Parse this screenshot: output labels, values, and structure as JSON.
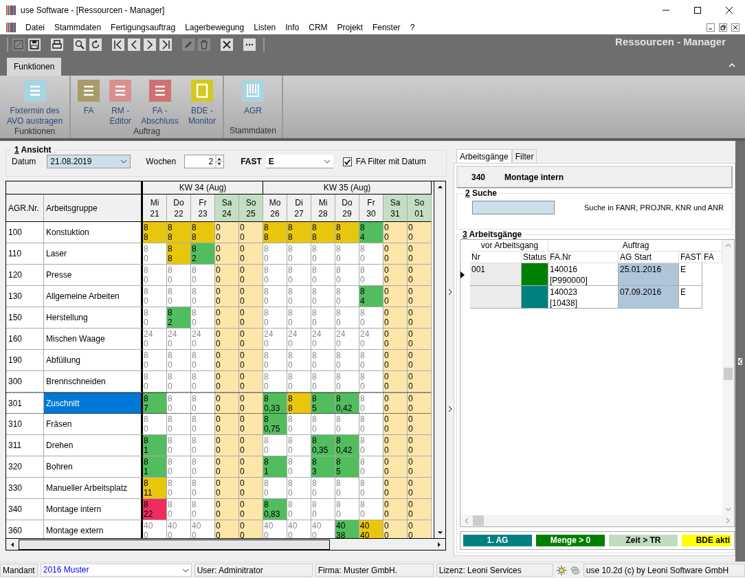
{
  "window": {
    "title": "use Software - [Ressourcen - Manager]"
  },
  "menu": [
    "Datei",
    "Stammdaten",
    "Fertigungsauftrag",
    "Lagerbewegung",
    "Listen",
    "Info",
    "CRM",
    "Projekt",
    "Fenster",
    "?"
  ],
  "toolbar": [
    {
      "kind": "new",
      "disabled": true
    },
    {
      "kind": "save",
      "disabled": false
    },
    {
      "kind": "print",
      "disabled": false
    },
    {
      "kind": "search",
      "disabled": false
    },
    {
      "kind": "refresh",
      "disabled": false
    },
    {
      "kind": "first",
      "disabled": false
    },
    {
      "kind": "prev",
      "disabled": false
    },
    {
      "kind": "next",
      "disabled": false
    },
    {
      "kind": "last",
      "disabled": false
    },
    {
      "kind": "edit",
      "disabled": true
    },
    {
      "kind": "delete",
      "disabled": true
    },
    {
      "kind": "close",
      "disabled": false
    },
    {
      "kind": "more",
      "disabled": false
    }
  ],
  "module_title": "Ressourcen - Manager",
  "ribbon_tabs": [
    {
      "label": "Funktionen",
      "selected": true
    }
  ],
  "ribbon_groups": [
    {
      "label": "Funktionen",
      "buttons": [
        {
          "label_lines": [
            "Fixtermin des",
            "AVO austragen"
          ],
          "kind": "list",
          "color": "#a8d4e0"
        }
      ]
    },
    {
      "label": "Auftrag",
      "buttons": [
        {
          "label_lines": [
            "FA"
          ],
          "kind": "list",
          "color": "#a89a6a"
        },
        {
          "label_lines": [
            "RM -",
            "Editor"
          ],
          "kind": "list",
          "color": "#d89090"
        },
        {
          "label_lines": [
            "FA -",
            "Abschluss"
          ],
          "kind": "list",
          "color": "#d07070"
        },
        {
          "label_lines": [
            "BDE -",
            "Monitor"
          ],
          "kind": "frame",
          "color": "#d4c820"
        }
      ]
    },
    {
      "label": "Stammdaten",
      "buttons": [
        {
          "label_lines": [
            "AGR"
          ],
          "kind": "columns",
          "color": "#a8d4e0"
        }
      ]
    }
  ],
  "view": {
    "title_key": "1",
    "title": "Ansicht",
    "date_label": "Datum",
    "date": "21.08.2019",
    "weeks_label": "Wochen",
    "weeks": "2",
    "fast_label": "FAST",
    "fast": "E",
    "date_filter_label": "FA Filter mit Datum",
    "date_filter_checked": true
  },
  "table": {
    "columns": [
      "AGR.Nr.",
      "Arbeitsgruppe"
    ],
    "weeks": [
      {
        "label": "KW 34 (Aug)",
        "days": [
          {
            "weekday": "Mi",
            "date": "21",
            "weekend": false
          },
          {
            "weekday": "Do",
            "date": "22",
            "weekend": false
          },
          {
            "weekday": "Fr",
            "date": "23",
            "weekend": false
          },
          {
            "weekday": "Sa",
            "date": "24",
            "weekend": true
          },
          {
            "weekday": "So",
            "date": "25",
            "weekend": true
          }
        ]
      },
      {
        "label": "KW 35 (Aug)",
        "days": [
          {
            "weekday": "Mo",
            "date": "26",
            "weekend": false
          },
          {
            "weekday": "Di",
            "date": "27",
            "weekend": false
          },
          {
            "weekday": "Mi",
            "date": "28",
            "weekend": false
          },
          {
            "weekday": "Do",
            "date": "29",
            "weekend": false
          },
          {
            "weekday": "Fr",
            "date": "30",
            "weekend": false
          },
          {
            "weekday": "Sa",
            "date": "31",
            "weekend": true
          },
          {
            "weekday": "So",
            "date": "01",
            "weekend": true
          }
        ]
      }
    ],
    "rows": [
      {
        "nr": "100",
        "name": "Konstuktion",
        "selected": false,
        "cells": [
          {
            "plan": "8",
            "booked": "8",
            "color": "#e9c60e"
          },
          {
            "plan": "8",
            "booked": "8",
            "color": "#e9c60e"
          },
          {
            "plan": "8",
            "booked": "8",
            "color": "#e9c60e"
          },
          {
            "plan": "0",
            "booked": "0",
            "color": "#fde6aa"
          },
          {
            "plan": "0",
            "booked": "0",
            "color": "#fde6aa"
          },
          {
            "plan": "8",
            "booked": "8",
            "color": "#e9c60e"
          },
          {
            "plan": "8",
            "booked": "8",
            "color": "#e9c60e"
          },
          {
            "plan": "8",
            "booked": "8",
            "color": "#e9c60e"
          },
          {
            "plan": "8",
            "booked": "8",
            "color": "#e9c60e"
          },
          {
            "plan": "8",
            "booked": "4",
            "color": "#52bd5e"
          },
          {
            "plan": "0",
            "booked": "0",
            "color": "#fde6aa"
          },
          {
            "plan": "0",
            "booked": "0",
            "color": "#fde6aa"
          }
        ]
      },
      {
        "nr": "110",
        "name": "Laser",
        "selected": false,
        "cells": [
          {
            "plan": "8",
            "booked": "0",
            "color": "#ffffff"
          },
          {
            "plan": "8",
            "booked": "8",
            "color": "#e9c60e"
          },
          {
            "plan": "8",
            "booked": "2",
            "color": "#52bd5e"
          },
          {
            "plan": "0",
            "booked": "0",
            "color": "#fde6aa"
          },
          {
            "plan": "0",
            "booked": "0",
            "color": "#fde6aa"
          },
          {
            "plan": "8",
            "booked": "0",
            "color": "#ffffff"
          },
          {
            "plan": "8",
            "booked": "0",
            "color": "#ffffff"
          },
          {
            "plan": "8",
            "booked": "0",
            "color": "#ffffff"
          },
          {
            "plan": "8",
            "booked": "0",
            "color": "#ffffff"
          },
          {
            "plan": "8",
            "booked": "0",
            "color": "#ffffff"
          },
          {
            "plan": "0",
            "booked": "0",
            "color": "#fde6aa"
          },
          {
            "plan": "0",
            "booked": "0",
            "color": "#fde6aa"
          }
        ]
      },
      {
        "nr": "120",
        "name": "Presse",
        "selected": false,
        "cells": [
          {
            "plan": "8",
            "booked": "0",
            "color": "#ffffff"
          },
          {
            "plan": "8",
            "booked": "0",
            "color": "#ffffff"
          },
          {
            "plan": "8",
            "booked": "0",
            "color": "#ffffff"
          },
          {
            "plan": "0",
            "booked": "0",
            "color": "#fde6aa"
          },
          {
            "plan": "0",
            "booked": "0",
            "color": "#fde6aa"
          },
          {
            "plan": "8",
            "booked": "0",
            "color": "#ffffff"
          },
          {
            "plan": "8",
            "booked": "0",
            "color": "#ffffff"
          },
          {
            "plan": "8",
            "booked": "0",
            "color": "#ffffff"
          },
          {
            "plan": "8",
            "booked": "0",
            "color": "#ffffff"
          },
          {
            "plan": "8",
            "booked": "0",
            "color": "#ffffff"
          },
          {
            "plan": "0",
            "booked": "0",
            "color": "#fde6aa"
          },
          {
            "plan": "0",
            "booked": "0",
            "color": "#fde6aa"
          }
        ]
      },
      {
        "nr": "130",
        "name": "Allgemeine Arbeiten",
        "selected": false,
        "cells": [
          {
            "plan": "8",
            "booked": "0",
            "color": "#ffffff"
          },
          {
            "plan": "8",
            "booked": "0",
            "color": "#ffffff"
          },
          {
            "plan": "8",
            "booked": "0",
            "color": "#ffffff"
          },
          {
            "plan": "0",
            "booked": "0",
            "color": "#fde6aa"
          },
          {
            "plan": "0",
            "booked": "0",
            "color": "#fde6aa"
          },
          {
            "plan": "8",
            "booked": "0",
            "color": "#ffffff"
          },
          {
            "plan": "8",
            "booked": "0",
            "color": "#ffffff"
          },
          {
            "plan": "8",
            "booked": "0",
            "color": "#ffffff"
          },
          {
            "plan": "8",
            "booked": "0",
            "color": "#ffffff"
          },
          {
            "plan": "8",
            "booked": "4",
            "color": "#52bd5e"
          },
          {
            "plan": "0",
            "booked": "0",
            "color": "#fde6aa"
          },
          {
            "plan": "0",
            "booked": "0",
            "color": "#fde6aa"
          }
        ]
      },
      {
        "nr": "150",
        "name": "Herstellung",
        "selected": false,
        "cells": [
          {
            "plan": "8",
            "booked": "0",
            "color": "#ffffff"
          },
          {
            "plan": "8",
            "booked": "2",
            "color": "#52bd5e"
          },
          {
            "plan": "8",
            "booked": "0",
            "color": "#ffffff"
          },
          {
            "plan": "0",
            "booked": "0",
            "color": "#fde6aa"
          },
          {
            "plan": "0",
            "booked": "0",
            "color": "#fde6aa"
          },
          {
            "plan": "8",
            "booked": "0",
            "color": "#ffffff"
          },
          {
            "plan": "8",
            "booked": "0",
            "color": "#ffffff"
          },
          {
            "plan": "8",
            "booked": "0",
            "color": "#ffffff"
          },
          {
            "plan": "8",
            "booked": "0",
            "color": "#ffffff"
          },
          {
            "plan": "8",
            "booked": "0",
            "color": "#ffffff"
          },
          {
            "plan": "0",
            "booked": "0",
            "color": "#fde6aa"
          },
          {
            "plan": "0",
            "booked": "0",
            "color": "#fde6aa"
          }
        ]
      },
      {
        "nr": "160",
        "name": "Mischen Waage",
        "selected": false,
        "cells": [
          {
            "plan": "24",
            "booked": "0",
            "color": "#ffffff"
          },
          {
            "plan": "24",
            "booked": "0",
            "color": "#ffffff"
          },
          {
            "plan": "24",
            "booked": "0",
            "color": "#ffffff"
          },
          {
            "plan": "0",
            "booked": "0",
            "color": "#fde6aa"
          },
          {
            "plan": "0",
            "booked": "0",
            "color": "#fde6aa"
          },
          {
            "plan": "24",
            "booked": "0",
            "color": "#ffffff"
          },
          {
            "plan": "24",
            "booked": "0",
            "color": "#ffffff"
          },
          {
            "plan": "24",
            "booked": "0",
            "color": "#ffffff"
          },
          {
            "plan": "24",
            "booked": "0",
            "color": "#ffffff"
          },
          {
            "plan": "24",
            "booked": "0",
            "color": "#ffffff"
          },
          {
            "plan": "0",
            "booked": "0",
            "color": "#fde6aa"
          },
          {
            "plan": "0",
            "booked": "0",
            "color": "#fde6aa"
          }
        ]
      },
      {
        "nr": "190",
        "name": "Abfüllung",
        "selected": false,
        "cells": [
          {
            "plan": "8",
            "booked": "0",
            "color": "#ffffff"
          },
          {
            "plan": "8",
            "booked": "0",
            "color": "#ffffff"
          },
          {
            "plan": "8",
            "booked": "0",
            "color": "#ffffff"
          },
          {
            "plan": "0",
            "booked": "0",
            "color": "#fde6aa"
          },
          {
            "plan": "0",
            "booked": "0",
            "color": "#fde6aa"
          },
          {
            "plan": "8",
            "booked": "0",
            "color": "#ffffff"
          },
          {
            "plan": "8",
            "booked": "0",
            "color": "#ffffff"
          },
          {
            "plan": "8",
            "booked": "0",
            "color": "#ffffff"
          },
          {
            "plan": "8",
            "booked": "0",
            "color": "#ffffff"
          },
          {
            "plan": "8",
            "booked": "0",
            "color": "#ffffff"
          },
          {
            "plan": "0",
            "booked": "0",
            "color": "#fde6aa"
          },
          {
            "plan": "0",
            "booked": "0",
            "color": "#fde6aa"
          }
        ]
      },
      {
        "nr": "300",
        "name": "Brennschneiden",
        "selected": false,
        "cells": [
          {
            "plan": "8",
            "booked": "0",
            "color": "#ffffff"
          },
          {
            "plan": "8",
            "booked": "0",
            "color": "#ffffff"
          },
          {
            "plan": "8",
            "booked": "0",
            "color": "#ffffff"
          },
          {
            "plan": "0",
            "booked": "0",
            "color": "#fde6aa"
          },
          {
            "plan": "0",
            "booked": "0",
            "color": "#fde6aa"
          },
          {
            "plan": "8",
            "booked": "0",
            "color": "#ffffff"
          },
          {
            "plan": "8",
            "booked": "0",
            "color": "#ffffff"
          },
          {
            "plan": "8",
            "booked": "0",
            "color": "#ffffff"
          },
          {
            "plan": "8",
            "booked": "0",
            "color": "#ffffff"
          },
          {
            "plan": "8",
            "booked": "0",
            "color": "#ffffff"
          },
          {
            "plan": "0",
            "booked": "0",
            "color": "#fde6aa"
          },
          {
            "plan": "0",
            "booked": "0",
            "color": "#fde6aa"
          }
        ]
      },
      {
        "nr": "301",
        "name": "Zuschnitt",
        "selected": true,
        "cells": [
          {
            "plan": "8",
            "booked": "7",
            "color": "#52bd5e"
          },
          {
            "plan": "8",
            "booked": "0",
            "color": "#ffffff"
          },
          {
            "plan": "8",
            "booked": "0",
            "color": "#ffffff"
          },
          {
            "plan": "0",
            "booked": "0",
            "color": "#fde6aa"
          },
          {
            "plan": "0",
            "booked": "0",
            "color": "#fde6aa"
          },
          {
            "plan": "8",
            "booked": "0,33",
            "color": "#52bd5e"
          },
          {
            "plan": "8",
            "booked": "8",
            "color": "#e9c60e"
          },
          {
            "plan": "8",
            "booked": "5",
            "color": "#52bd5e"
          },
          {
            "plan": "8",
            "booked": "0,42",
            "color": "#52bd5e"
          },
          {
            "plan": "8",
            "booked": "0",
            "color": "#ffffff"
          },
          {
            "plan": "0",
            "booked": "0",
            "color": "#fde6aa"
          },
          {
            "plan": "0",
            "booked": "0",
            "color": "#fde6aa"
          }
        ]
      },
      {
        "nr": "310",
        "name": "Fräsen",
        "selected": false,
        "cells": [
          {
            "plan": "8",
            "booked": "0",
            "color": "#ffffff"
          },
          {
            "plan": "8",
            "booked": "0",
            "color": "#ffffff"
          },
          {
            "plan": "8",
            "booked": "0",
            "color": "#ffffff"
          },
          {
            "plan": "0",
            "booked": "0",
            "color": "#fde6aa"
          },
          {
            "plan": "0",
            "booked": "0",
            "color": "#fde6aa"
          },
          {
            "plan": "8",
            "booked": "0,75",
            "color": "#52bd5e"
          },
          {
            "plan": "8",
            "booked": "0",
            "color": "#ffffff"
          },
          {
            "plan": "8",
            "booked": "0",
            "color": "#ffffff"
          },
          {
            "plan": "8",
            "booked": "0",
            "color": "#ffffff"
          },
          {
            "plan": "8",
            "booked": "0",
            "color": "#ffffff"
          },
          {
            "plan": "0",
            "booked": "0",
            "color": "#fde6aa"
          },
          {
            "plan": "0",
            "booked": "0",
            "color": "#fde6aa"
          }
        ]
      },
      {
        "nr": "311",
        "name": "Drehen",
        "selected": false,
        "cells": [
          {
            "plan": "8",
            "booked": "1",
            "color": "#52bd5e"
          },
          {
            "plan": "8",
            "booked": "0",
            "color": "#ffffff"
          },
          {
            "plan": "8",
            "booked": "0",
            "color": "#ffffff"
          },
          {
            "plan": "0",
            "booked": "0",
            "color": "#fde6aa"
          },
          {
            "plan": "0",
            "booked": "0",
            "color": "#fde6aa"
          },
          {
            "plan": "8",
            "booked": "0",
            "color": "#ffffff"
          },
          {
            "plan": "8",
            "booked": "0",
            "color": "#ffffff"
          },
          {
            "plan": "8",
            "booked": "0,35",
            "color": "#52bd5e"
          },
          {
            "plan": "8",
            "booked": "0,42",
            "color": "#52bd5e"
          },
          {
            "plan": "8",
            "booked": "0",
            "color": "#ffffff"
          },
          {
            "plan": "0",
            "booked": "0",
            "color": "#fde6aa"
          },
          {
            "plan": "0",
            "booked": "0",
            "color": "#fde6aa"
          }
        ]
      },
      {
        "nr": "320",
        "name": "Bohren",
        "selected": false,
        "cells": [
          {
            "plan": "8",
            "booked": "1",
            "color": "#52bd5e"
          },
          {
            "plan": "8",
            "booked": "0",
            "color": "#ffffff"
          },
          {
            "plan": "8",
            "booked": "0",
            "color": "#ffffff"
          },
          {
            "plan": "0",
            "booked": "0",
            "color": "#fde6aa"
          },
          {
            "plan": "0",
            "booked": "0",
            "color": "#fde6aa"
          },
          {
            "plan": "8",
            "booked": "1",
            "color": "#52bd5e"
          },
          {
            "plan": "8",
            "booked": "0",
            "color": "#ffffff"
          },
          {
            "plan": "8",
            "booked": "3",
            "color": "#52bd5e"
          },
          {
            "plan": "8",
            "booked": "5",
            "color": "#52bd5e"
          },
          {
            "plan": "8",
            "booked": "0",
            "color": "#ffffff"
          },
          {
            "plan": "0",
            "booked": "0",
            "color": "#fde6aa"
          },
          {
            "plan": "0",
            "booked": "0",
            "color": "#fde6aa"
          }
        ]
      },
      {
        "nr": "330",
        "name": "Manueller Arbeitsplatz",
        "selected": false,
        "cells": [
          {
            "plan": "8",
            "booked": "11",
            "color": "#e9c60e"
          },
          {
            "plan": "8",
            "booked": "0",
            "color": "#ffffff"
          },
          {
            "plan": "8",
            "booked": "0",
            "color": "#ffffff"
          },
          {
            "plan": "0",
            "booked": "0",
            "color": "#fde6aa"
          },
          {
            "plan": "0",
            "booked": "0",
            "color": "#fde6aa"
          },
          {
            "plan": "8",
            "booked": "0",
            "color": "#ffffff"
          },
          {
            "plan": "8",
            "booked": "0",
            "color": "#ffffff"
          },
          {
            "plan": "8",
            "booked": "0",
            "color": "#ffffff"
          },
          {
            "plan": "8",
            "booked": "0",
            "color": "#ffffff"
          },
          {
            "plan": "8",
            "booked": "0",
            "color": "#ffffff"
          },
          {
            "plan": "0",
            "booked": "0",
            "color": "#fde6aa"
          },
          {
            "plan": "0",
            "booked": "0",
            "color": "#fde6aa"
          }
        ]
      },
      {
        "nr": "340",
        "name": "Montage intern",
        "selected": false,
        "cells": [
          {
            "plan": "8",
            "booked": "22",
            "color": "#ee2c60"
          },
          {
            "plan": "8",
            "booked": "0",
            "color": "#ffffff"
          },
          {
            "plan": "8",
            "booked": "0",
            "color": "#ffffff"
          },
          {
            "plan": "0",
            "booked": "0",
            "color": "#fde6aa"
          },
          {
            "plan": "0",
            "booked": "0",
            "color": "#fde6aa"
          },
          {
            "plan": "8",
            "booked": "0,83",
            "color": "#52bd5e"
          },
          {
            "plan": "8",
            "booked": "0",
            "color": "#ffffff"
          },
          {
            "plan": "8",
            "booked": "0",
            "color": "#ffffff"
          },
          {
            "plan": "8",
            "booked": "0",
            "color": "#ffffff"
          },
          {
            "plan": "8",
            "booked": "0",
            "color": "#ffffff"
          },
          {
            "plan": "0",
            "booked": "0",
            "color": "#fde6aa"
          },
          {
            "plan": "0",
            "booked": "0",
            "color": "#fde6aa"
          }
        ]
      },
      {
        "nr": "360",
        "name": "Montage extern",
        "selected": false,
        "cells": [
          {
            "plan": "40",
            "booked": "0",
            "color": "#ffffff"
          },
          {
            "plan": "40",
            "booked": "0",
            "color": "#ffffff"
          },
          {
            "plan": "40",
            "booked": "0",
            "color": "#ffffff"
          },
          {
            "plan": "0",
            "booked": "0",
            "color": "#fde6aa"
          },
          {
            "plan": "0",
            "booked": "0",
            "color": "#fde6aa"
          },
          {
            "plan": "40",
            "booked": "0",
            "color": "#ffffff"
          },
          {
            "plan": "40",
            "booked": "0",
            "color": "#ffffff"
          },
          {
            "plan": "40",
            "booked": "0",
            "color": "#ffffff"
          },
          {
            "plan": "40",
            "booked": "38",
            "color": "#52bd5e"
          },
          {
            "plan": "40",
            "booked": "40",
            "color": "#e9c60e"
          },
          {
            "plan": "0",
            "booked": "0",
            "color": "#fde6aa"
          },
          {
            "plan": "0",
            "booked": "0",
            "color": "#fde6aa"
          }
        ]
      }
    ]
  },
  "side_tabs": [
    {
      "label": "Arbeitsgänge",
      "selected": true
    },
    {
      "label": "Filter",
      "selected": false
    }
  ],
  "current_group": {
    "nr": "340",
    "name": "Montage intern"
  },
  "search": {
    "title_key": "2",
    "title": "Suche",
    "hint": "Suche in FANR, PROJNR, KNR und ANR"
  },
  "operations": {
    "title_key": "3",
    "title": "Arbeitsgänge",
    "group_headers": [
      "vor Arbeitsgang",
      "Auftrag"
    ],
    "columns": [
      "Nr",
      "Status",
      "FA.Nr",
      "AG Start",
      "FAST",
      "FA"
    ],
    "rows": [
      {
        "selected": true,
        "nr": "001",
        "color": "#008000",
        "fa_nr": "140016",
        "project": "[P990000]",
        "ag_start": "25.01.2016",
        "fast": "E"
      },
      {
        "selected": false,
        "color": "#008080",
        "fa_nr": "140023",
        "project": "[10438]",
        "ag_start": "07.09.2016",
        "fast": "E"
      }
    ]
  },
  "legend": [
    {
      "label": "1. AG",
      "color": "#008080"
    },
    {
      "label": "Menge > 0",
      "color": "#008000"
    },
    {
      "label": "Zeit > TR",
      "color": "#c0dcc0"
    },
    {
      "label": "BDE akti",
      "color": "#ffff00"
    }
  ],
  "status_bar": {
    "client_label": "Mandant",
    "client": "2016 Muster",
    "user": "User: Adminitrator",
    "company": "Firma: Muster GmbH.",
    "license": "Lizenz: Leoni Services",
    "version": "use 10.2d (c) by Leoni Software GmbH"
  }
}
